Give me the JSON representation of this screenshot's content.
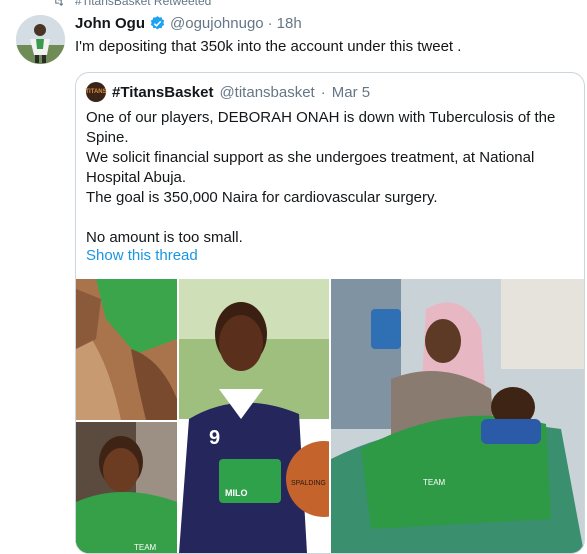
{
  "retweet_context": {
    "text": "#TitansBasket Retweeted",
    "icon": "retweet-icon"
  },
  "tweet": {
    "display_name": "John Ogu",
    "handle": "@ogujohnugo",
    "separator": "·",
    "time": "18h",
    "text": "I'm depositing that 350k into the account under this tweet .",
    "verified": true
  },
  "quoted_tweet": {
    "avatar_text": "TITANS",
    "display_name": "#TitansBasket",
    "handle": "@titansbasket",
    "separator": "·",
    "date": "Mar 5",
    "lines": [
      "One of our players, DEBORAH ONAH is down with Tuberculosis of the Spine.",
      "We solicit financial support as she undergoes treatment, at National Hospital Abuja.",
      "The goal is 350,000 Naira for cardiovascular surgery."
    ],
    "closing": "No amount is too small.",
    "show_thread": "Show this thread"
  },
  "photos": {
    "photo1_caption": "",
    "photo2_jersey_text": "TEAM",
    "photo3_jersey_number": "9",
    "photo3_logo_text": "MILO",
    "photo3_ball_text": "SPALDING",
    "photo4_jersey_text": "TEAM"
  },
  "colors": {
    "link": "#1b95e0",
    "muted": "#657786",
    "border": "#ccd6dd",
    "verified": "#1da1f2"
  }
}
